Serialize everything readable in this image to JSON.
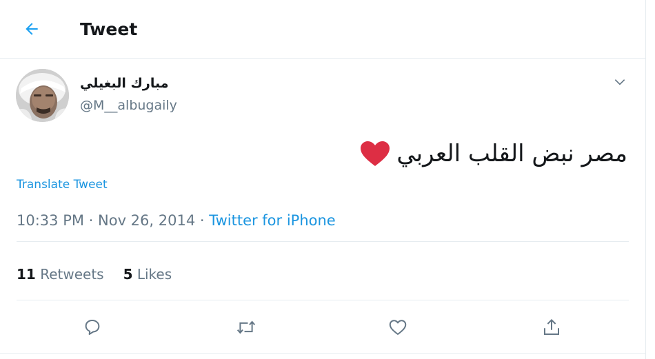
{
  "header": {
    "title": "Tweet",
    "back_icon": "arrow-left-icon"
  },
  "author": {
    "name": "مبارك البغيلي",
    "handle": "@M__albugaily"
  },
  "tweet": {
    "text": "مصر نبض القلب العربي",
    "emoji": "red-heart-icon",
    "translate_label": "Translate Tweet",
    "time": "10:33 PM",
    "separator": " · ",
    "date": "Nov 26, 2014",
    "source": "Twitter for iPhone"
  },
  "stats": {
    "retweets_count": "11",
    "retweets_label": "Retweets",
    "likes_count": "5",
    "likes_label": "Likes"
  },
  "actions": [
    "reply-icon",
    "retweet-icon",
    "like-icon",
    "share-icon"
  ],
  "colors": {
    "accent": "#1da1f2",
    "link": "#1b95e0",
    "muted": "#657786",
    "text": "#14171a",
    "divider": "#e6ecf0",
    "heart": "#e0245e"
  }
}
